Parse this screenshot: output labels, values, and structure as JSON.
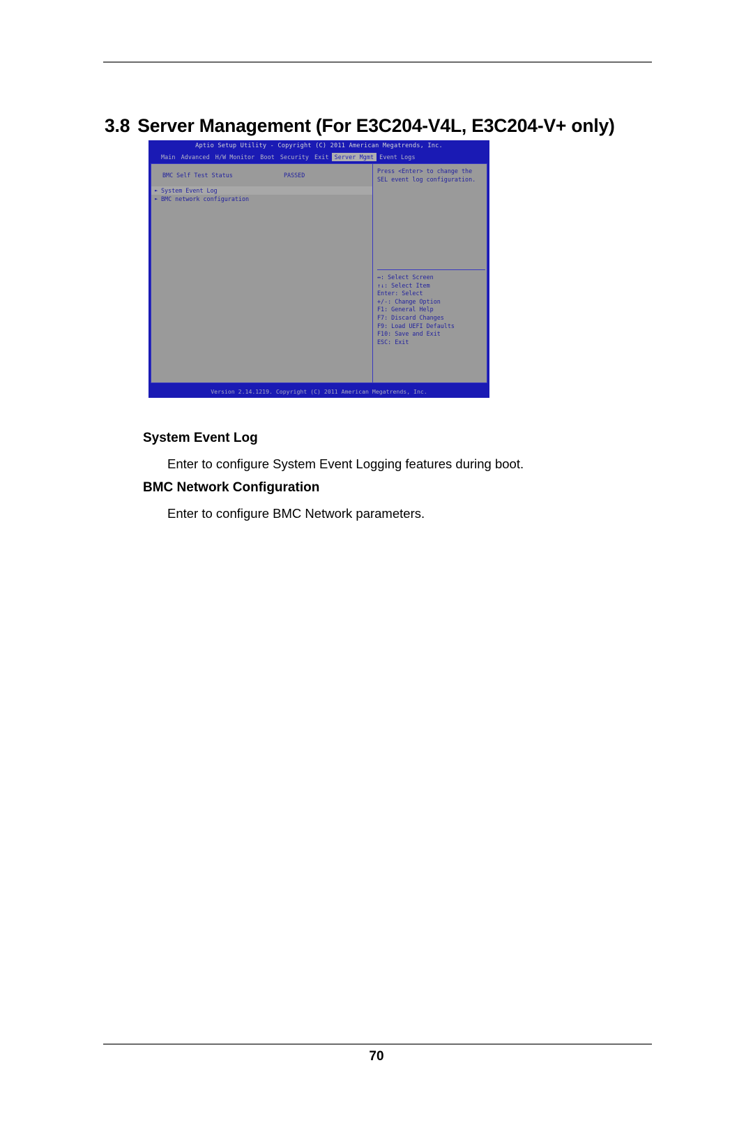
{
  "document": {
    "section_number": "3.8",
    "section_title": "Server Management (For E3C204-V4L, E3C204-V+ only)",
    "page_number": "70"
  },
  "bios": {
    "title": "Aptio Setup Utility - Copyright (C) 2011 American Megatrends, Inc.",
    "version_bar": "Version 2.14.1219. Copyright (C) 2011 American Megatrends, Inc.",
    "menu_tabs": [
      {
        "label": "Main",
        "active": false
      },
      {
        "label": "Advanced",
        "active": false
      },
      {
        "label": "H/W Monitor",
        "active": false
      },
      {
        "label": "Boot",
        "active": false
      },
      {
        "label": "Security",
        "active": false
      },
      {
        "label": "Exit",
        "active": false
      },
      {
        "label": "Server Mgmt",
        "active": true
      },
      {
        "label": "Event Logs",
        "active": false
      }
    ],
    "status_row": {
      "label": "BMC Self Test Status",
      "value": "PASSED"
    },
    "menu_items": [
      {
        "label": "System Event Log",
        "selected": true
      },
      {
        "label": "BMC network configuration",
        "selected": false
      }
    ],
    "help": {
      "line1": "Press <Enter> to change the",
      "line2": "SEL event log configuration."
    },
    "legend": [
      {
        "key": "↔",
        "text": ": Select Screen"
      },
      {
        "key": "↑↓",
        "text": ": Select Item"
      },
      {
        "key": "Enter",
        "text": ": Select"
      },
      {
        "key": "+/-",
        "text": ": Change Option"
      },
      {
        "key": "F1",
        "text": ": General Help"
      },
      {
        "key": "F7",
        "text": ": Discard Changes"
      },
      {
        "key": "F9",
        "text": ": Load UEFI Defaults"
      },
      {
        "key": "F10",
        "text": ": Save and Exit"
      },
      {
        "key": "ESC",
        "text": ": Exit"
      }
    ],
    "colors": {
      "background": "#1a1ab4",
      "panel": "#9a9a9a",
      "text": "#22229e",
      "highlight": "#b0b0b0"
    }
  },
  "descriptions": [
    {
      "heading": "System Event Log",
      "text": "Enter to configure System Event Logging features during boot."
    },
    {
      "heading": "BMC Network Configuration",
      "text": "Enter to configure BMC Network parameters."
    }
  ]
}
